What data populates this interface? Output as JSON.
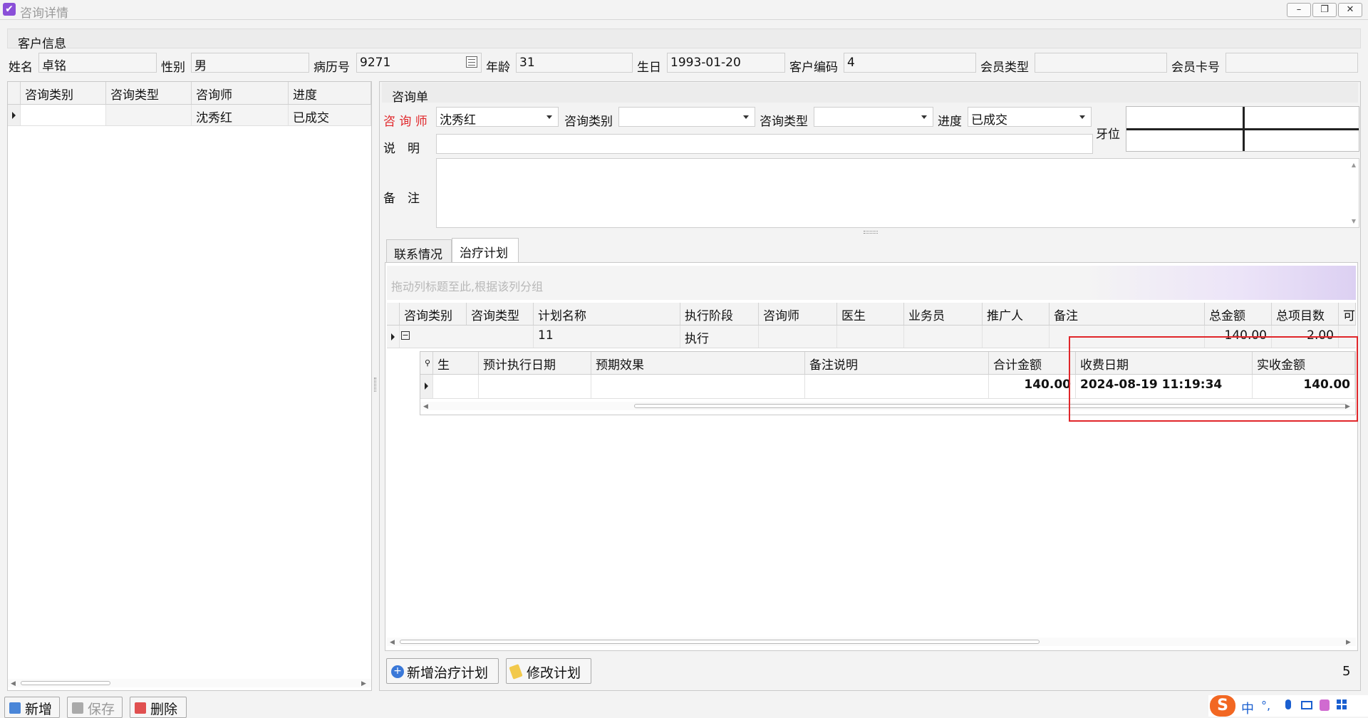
{
  "window": {
    "title": "咨询详情",
    "min": "–",
    "restore": "❐",
    "close": "✕"
  },
  "customer": {
    "section_title": "客户信息",
    "fields": [
      {
        "label": "姓名",
        "value": "卓铭"
      },
      {
        "label": "性别",
        "value": "男"
      },
      {
        "label": "病历号",
        "value": "9271"
      },
      {
        "label": "年龄",
        "value": "31"
      },
      {
        "label": "生日",
        "value": "1993-01-20"
      },
      {
        "label": "客户编码",
        "value": "4"
      },
      {
        "label": "会员类型",
        "value": ""
      },
      {
        "label": "会员卡号",
        "value": ""
      }
    ]
  },
  "left_grid": {
    "columns": [
      "咨询类别",
      "咨询类型",
      "咨询师",
      "进度"
    ],
    "rows": [
      {
        "cells": [
          "",
          "",
          "沈秀红",
          "已成交"
        ]
      }
    ]
  },
  "consult_form": {
    "section_title": "咨询单",
    "consultant_label": "咨 询 师",
    "consultant_value": "沈秀红",
    "category_label": "咨询类别",
    "category_value": "",
    "type_label": "咨询类型",
    "type_value": "",
    "progress_label": "进度",
    "progress_value": "已成交",
    "tooth_label": "牙位",
    "desc_label": "说　明",
    "desc_value": "",
    "remark_label": "备　注",
    "remark_value": ""
  },
  "tabs": [
    {
      "label": "联系情况"
    },
    {
      "label": "治疗计划"
    }
  ],
  "plan_grid": {
    "group_hint": "拖动列标题至此,根据该列分组",
    "columns": [
      "咨询类别",
      "咨询类型",
      "计划名称",
      "执行阶段",
      "咨询师",
      "医生",
      "业务员",
      "推广人",
      "备注",
      "总金额",
      "总项目数",
      "可手"
    ],
    "row": {
      "plan_name": "11",
      "stage": "执行",
      "total": "140.00",
      "count": "2.00"
    },
    "detail_columns": [
      "生",
      "预计执行日期",
      "预期效果",
      "备注说明",
      "合计金额",
      "收费日期",
      "实收金额"
    ],
    "detail_row": {
      "subtotal": "140.00",
      "pay_date": "2024-08-19 11:19:34",
      "received": "140.00"
    }
  },
  "plan_buttons": {
    "add": "新增治疗计划",
    "edit": "修改计划",
    "count": "5"
  },
  "footer_buttons": {
    "new": "新增",
    "save": "保存",
    "delete": "删除"
  },
  "ime": {
    "lang": "中",
    "punct": "°,"
  }
}
